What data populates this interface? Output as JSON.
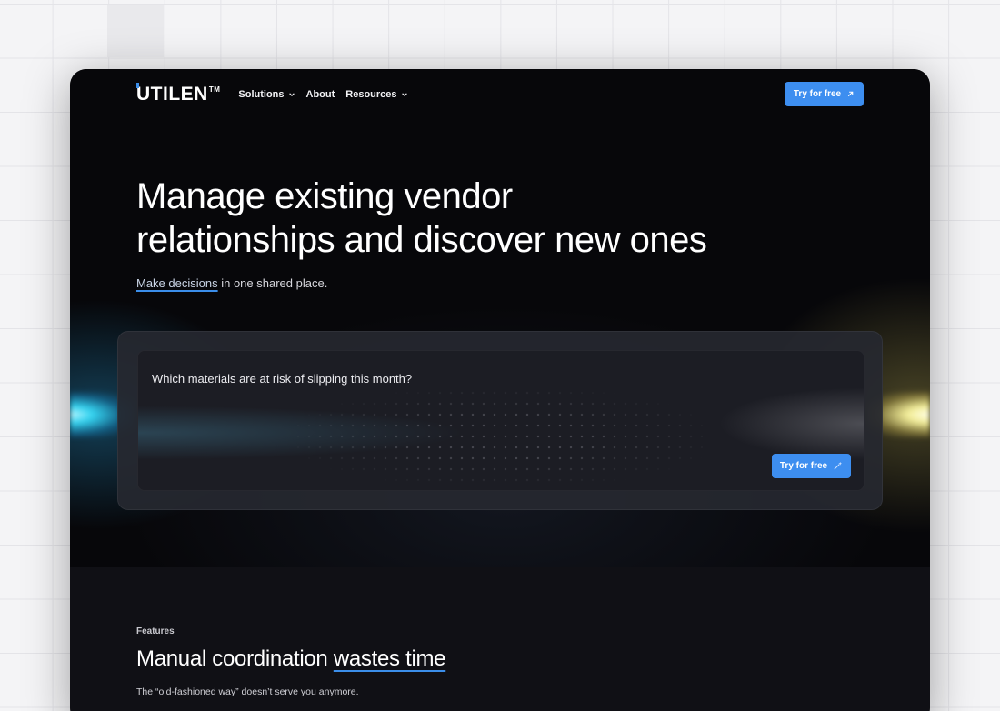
{
  "nav": {
    "logo_main": "UTILEN",
    "logo_mark": "TM",
    "links": [
      {
        "label": "Solutions",
        "has_dropdown": true
      },
      {
        "label": "About",
        "has_dropdown": false
      },
      {
        "label": "Resources",
        "has_dropdown": true
      }
    ],
    "cta_label": "Try for free",
    "cta_icon": "arrow-up-right-icon"
  },
  "hero": {
    "title_line1": "Manage existing vendor",
    "title_line2": "relationships and discover new ones",
    "subtitle_link": "Make decisions",
    "subtitle_rest": " in one shared place."
  },
  "prompt": {
    "text": "Which materials are at risk of slipping this month?",
    "cta_label": "Try for free",
    "cta_icon": "sparkle-wand-icon"
  },
  "features": {
    "label": "Features",
    "title_plain": "Manual coordination ",
    "title_highlight": "wastes time",
    "subtitle": "The “old-fashioned way” doesn’t serve you anymore."
  },
  "colors": {
    "accent": "#3d8ef0",
    "hero_bg": "#07070a",
    "section_bg": "#101015",
    "page_bg": "#f4f4f6"
  }
}
